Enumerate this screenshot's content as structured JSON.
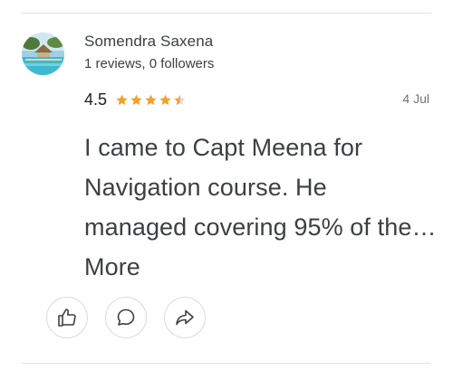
{
  "reviewer": {
    "name": "Somendra Saxena",
    "meta": "1 reviews, 0 followers",
    "avatar_icon": "beach-resort-photo"
  },
  "review": {
    "rating": "4.5",
    "stars_filled": 4.5,
    "stars_total": 5,
    "star_color": "#f4a02b",
    "date": "4 Jul",
    "text_lines": [
      "I came to Capt Meena for",
      "Navigation course. He",
      "managed covering 95% of the…",
      "More"
    ]
  },
  "actions": {
    "like_icon": "thumbs-up-icon",
    "comment_icon": "comment-icon",
    "share_icon": "share-icon"
  }
}
